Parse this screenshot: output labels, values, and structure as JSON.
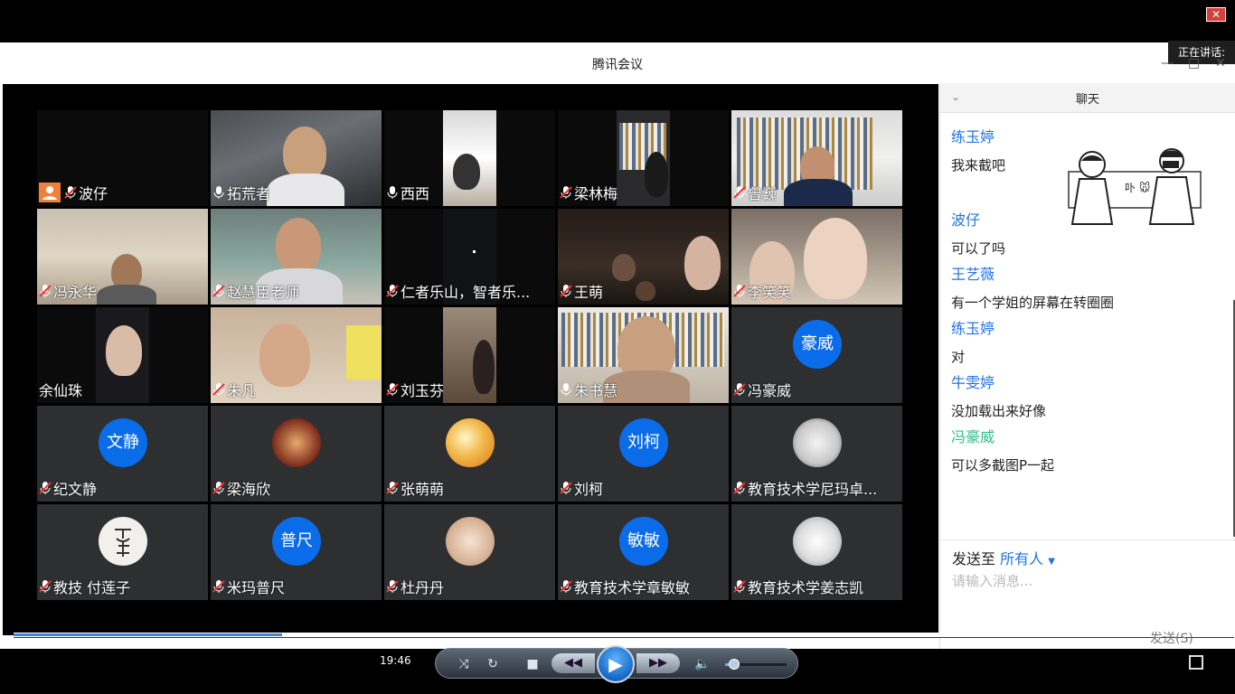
{
  "player": {
    "close_glyph": "✕",
    "time": "19:46",
    "progress": 0.22,
    "volume": 0.15
  },
  "meeting": {
    "title": "腾讯会议",
    "share_tag": "正在讲话:",
    "win_min": "—",
    "win_max": "□",
    "win_close": "✕"
  },
  "tiles": [
    {
      "name": "波仔",
      "host": true
    },
    {
      "name": "拓荒者"
    },
    {
      "name": "西西"
    },
    {
      "name": "梁林梅"
    },
    {
      "name": "曾巍"
    },
    {
      "name": "冯永华"
    },
    {
      "name": "赵慧臣老师"
    },
    {
      "name": "仁者乐山，智者乐..."
    },
    {
      "name": "王萌"
    },
    {
      "name": "李笑笑"
    },
    {
      "name": "余仙珠"
    },
    {
      "name": "朱凡"
    },
    {
      "name": "刘玉芬"
    },
    {
      "name": "朱书慧"
    },
    {
      "name": "冯豪威",
      "avatar": "豪威"
    },
    {
      "name": "纪文静",
      "avatar": "文静"
    },
    {
      "name": "梁海欣"
    },
    {
      "name": "张萌萌"
    },
    {
      "name": "刘柯",
      "avatar": "刘柯"
    },
    {
      "name": "教育技术学尼玛卓..."
    },
    {
      "name": "教技 付莲子"
    },
    {
      "name": "米玛普尺",
      "avatar": "普尺"
    },
    {
      "name": "杜丹丹"
    },
    {
      "name": "教育技术学章敏敏",
      "avatar": "敏敏"
    },
    {
      "name": "教育技术学姜志凯"
    }
  ],
  "chat": {
    "title": "聊天",
    "messages": [
      {
        "sender": "练玉婷",
        "text": "我来截吧"
      },
      {
        "sender": "波仔",
        "text": "可以了吗"
      },
      {
        "sender": "王艺薇",
        "text": "有一个学姐的屏幕在转圈圈"
      },
      {
        "sender": "练玉婷",
        "text": "对"
      },
      {
        "sender": "牛雯婷",
        "text": "没加载出来好像"
      },
      {
        "sender": "冯豪威",
        "text": "可以多截图P一起"
      }
    ],
    "send_to_label": "发送至",
    "send_to_target": "所有人",
    "input_placeholder": "请输入消息...",
    "send_button": "发送(S)"
  },
  "colors": {
    "accent": "#2273e3",
    "avatar_blue": "#0a6ce8",
    "host_orange": "#f0813a"
  }
}
